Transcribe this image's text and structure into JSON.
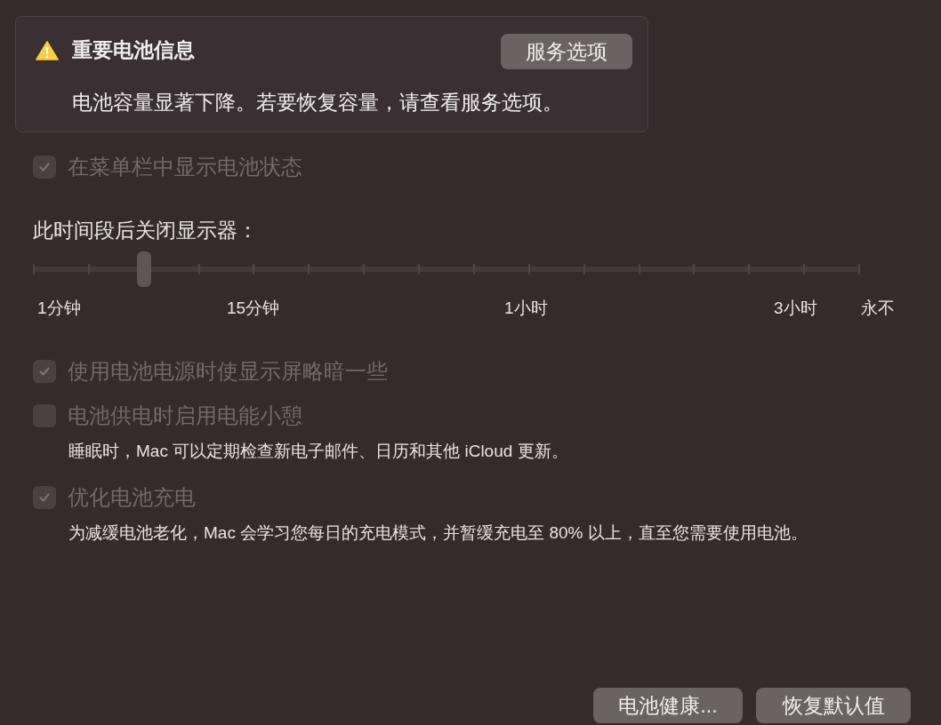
{
  "notice": {
    "title": "重要电池信息",
    "button": "服务选项",
    "message": "电池容量显著下降。若要恢复容量，请查看服务选项。"
  },
  "menu_bar_option": {
    "label": "在菜单栏中显示电池状态",
    "checked": true,
    "disabled": true
  },
  "display_off": {
    "label": "此时间段后关闭显示器：",
    "level": 0.1333,
    "scale_labels": [
      "1分钟",
      "15分钟",
      "1小时",
      "3小时",
      "永不"
    ]
  },
  "options": [
    {
      "label": "使用电池电源时使显示屏略暗一些",
      "checked": true,
      "disabled": true
    },
    {
      "label": "电池供电时启用电能小憩",
      "checked": false,
      "disabled": true,
      "description": "睡眠时，Mac 可以定期检查新电子邮件、日历和其他 iCloud 更新。"
    },
    {
      "label": "优化电池充电",
      "checked": true,
      "disabled": true,
      "description": "为减缓电池老化，Mac 会学习您每日的充电模式，并暂缓充电至 80% 以上，直至您需要使用电池。"
    }
  ],
  "buttons": [
    "电池健康...",
    "恢复默认值"
  ]
}
